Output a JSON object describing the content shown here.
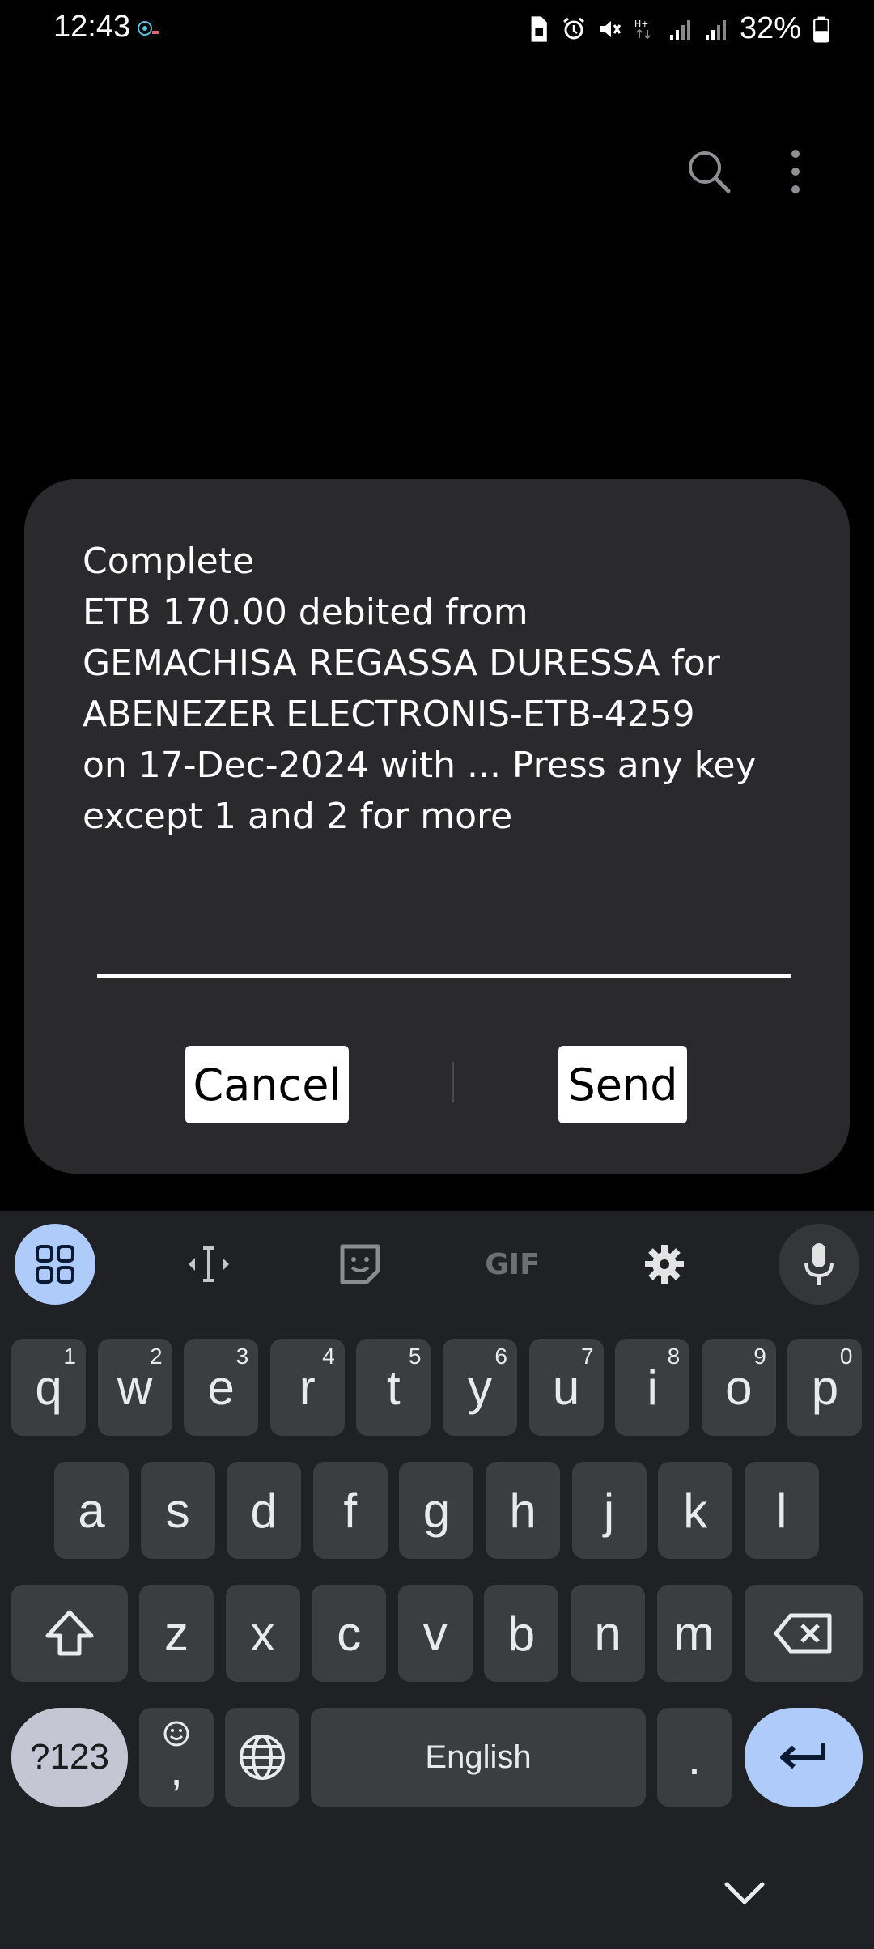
{
  "status_bar": {
    "time": "12:43",
    "battery_percent": "32%",
    "icons": [
      "data-saver-icon",
      "alarm-icon",
      "mute-icon",
      "network-hplus-icon",
      "signal-icon",
      "signal-icon",
      "battery-icon"
    ]
  },
  "toolbar": {
    "search_icon": "search-icon",
    "more_icon": "more-vert-icon"
  },
  "dialog": {
    "message": "Complete\nETB 170.00 debited from\nGEMACHISA REGASSA DURESSA for\nABENEZER ELECTRONIS-ETB-4259\non 17-Dec-2024 with ... Press any key\nexcept 1 and 2 for more",
    "input_value": "",
    "cancel_label": "Cancel",
    "send_label": "Send"
  },
  "keyboard": {
    "toolbar": [
      "apps-grid-icon",
      "text-cursor-icon",
      "sticker-icon",
      "GIF",
      "settings-icon",
      "mic-icon"
    ],
    "gif_label": "GIF",
    "row1": [
      [
        "q",
        "1"
      ],
      [
        "w",
        "2"
      ],
      [
        "e",
        "3"
      ],
      [
        "r",
        "4"
      ],
      [
        "t",
        "5"
      ],
      [
        "y",
        "6"
      ],
      [
        "u",
        "7"
      ],
      [
        "i",
        "8"
      ],
      [
        "o",
        "9"
      ],
      [
        "p",
        "0"
      ]
    ],
    "row2": [
      "a",
      "s",
      "d",
      "f",
      "g",
      "h",
      "j",
      "k",
      "l"
    ],
    "row3": [
      "z",
      "x",
      "c",
      "v",
      "b",
      "n",
      "m"
    ],
    "symbols_label": "?123",
    "comma_label": ",",
    "space_label": "English",
    "period_label": ".",
    "accent_color": "#aecbfa"
  }
}
